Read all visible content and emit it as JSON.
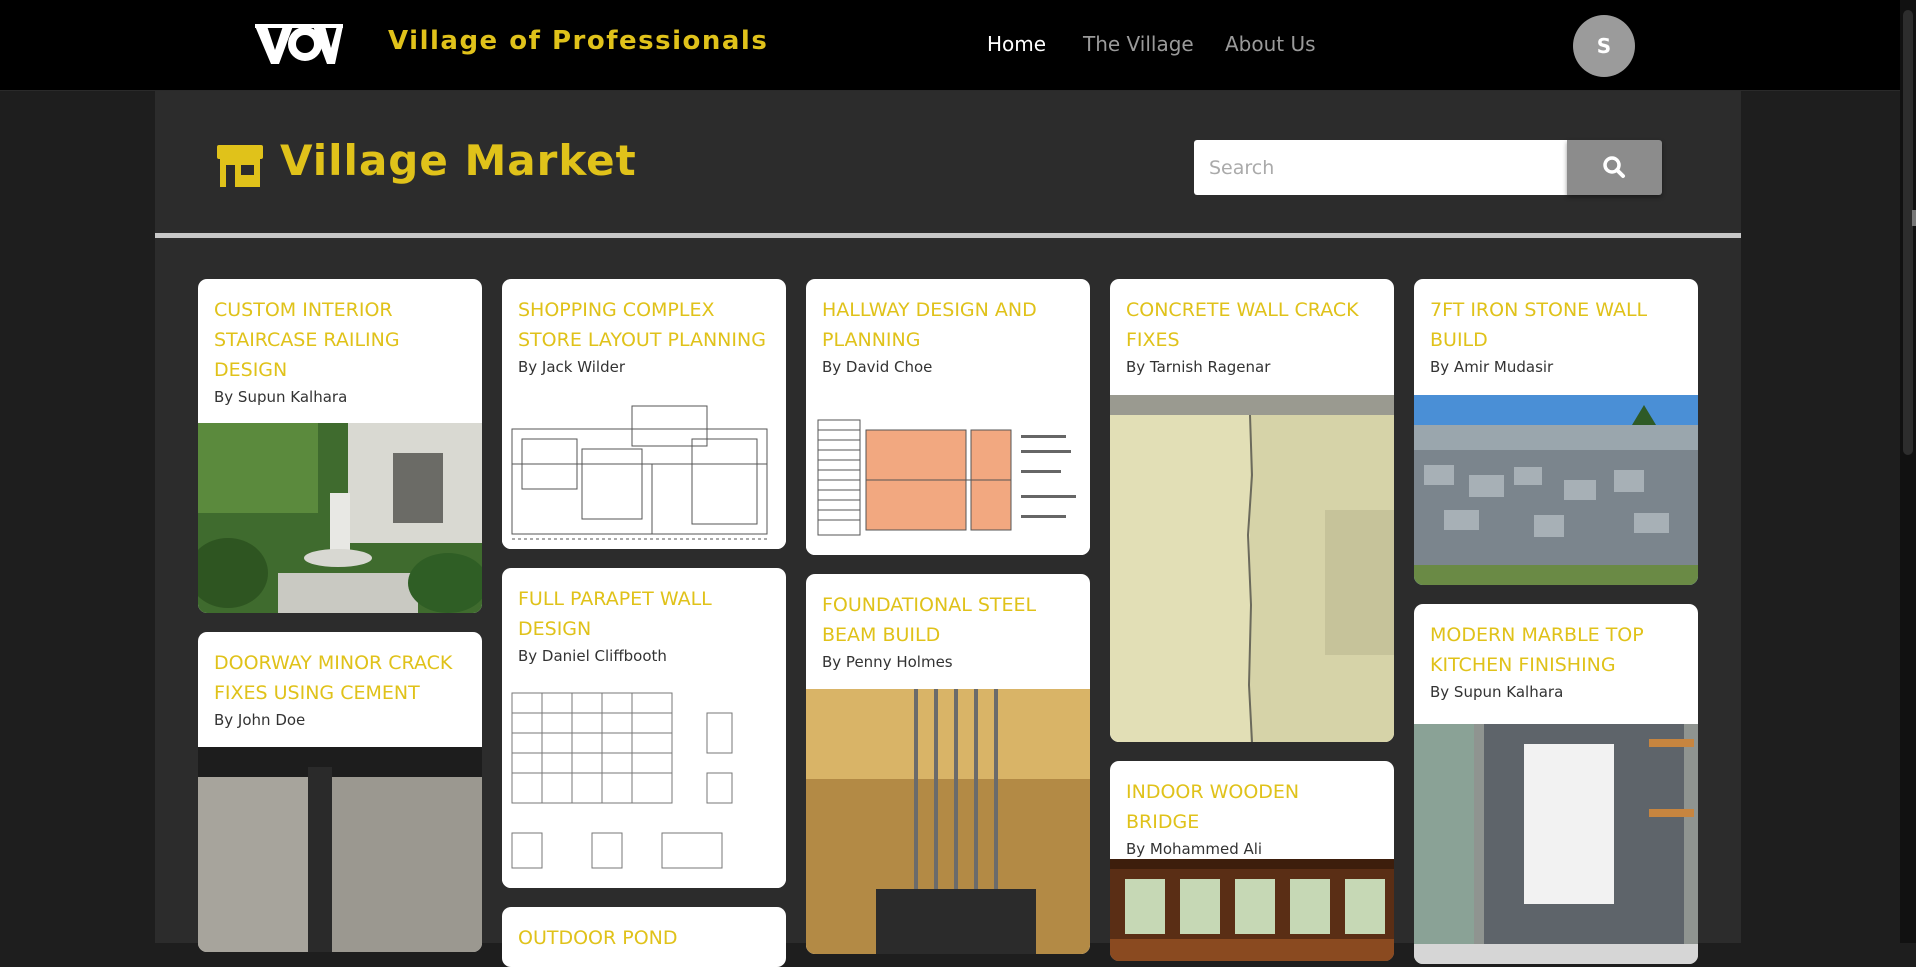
{
  "header": {
    "brand": "Village of Professionals",
    "logo_text": "VOV",
    "nav": [
      {
        "label": "Home",
        "active": true
      },
      {
        "label": "The Village",
        "active": false
      },
      {
        "label": "About Us",
        "active": false
      }
    ],
    "avatar_initial": "S"
  },
  "market": {
    "title": "Village Market",
    "icon": "storefront-icon",
    "search_placeholder": "Search",
    "search_icon": "search-icon"
  },
  "cards": [
    {
      "title": "CUSTOM INTERIOR STAIRCASE RAILING DESIGN",
      "author": "By Supun Kalhara",
      "image": "garden-fountain-photo"
    },
    {
      "title": "DOORWAY MINOR CRACK FIXES USING CEMENT",
      "author": "By John Doe",
      "image": "doorway-crack-photo"
    },
    {
      "title": "SHOPPING COMPLEX STORE LAYOUT PLANNING",
      "author": "By Jack Wilder",
      "image": "floor-plan-drawing"
    },
    {
      "title": "FULL PARAPET WALL DESIGN",
      "author": "By Daniel Cliffbooth",
      "image": "wall-elevation-drawing"
    },
    {
      "title": "OUTDOOR POND",
      "author": "",
      "image": ""
    },
    {
      "title": "HALLWAY DESIGN AND PLANNING",
      "author": "By David Choe",
      "image": "hallway-plan-drawing"
    },
    {
      "title": "FOUNDATIONAL STEEL BEAM BUILD",
      "author": "By Penny Holmes",
      "image": "steel-rebar-photo"
    },
    {
      "title": "CONCRETE WALL CRACK FIXES",
      "author": "By Tarnish Ragenar",
      "image": "wall-crack-photo"
    },
    {
      "title": "INDOOR WOODEN BRIDGE",
      "author": "By Mohammed Ali",
      "image": "wooden-bridge-photo"
    },
    {
      "title": "7FT IRON STONE WALL BUILD",
      "author": "By Amir Mudasir",
      "image": "stone-wall-photo"
    },
    {
      "title": "MODERN MARBLE TOP KITCHEN FINISHING",
      "author": "By Supun Kalhara",
      "image": "kitchen-photo"
    }
  ],
  "colors": {
    "accent": "#e0c21a",
    "topbar": "#000000",
    "panel": "#2c2c2c",
    "page": "#1e1e1e"
  }
}
